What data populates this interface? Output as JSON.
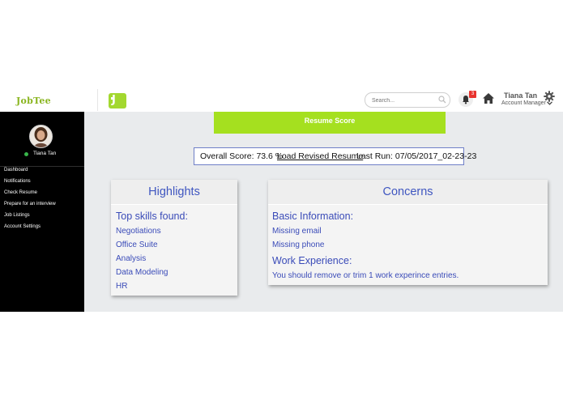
{
  "header": {
    "logo_text": "JobTee",
    "app_icon_glyph": "J",
    "search_placeholder": "Search...",
    "notification_count": "3",
    "user_name": "Tiana Tan",
    "user_role": "Account Manager"
  },
  "sidebar": {
    "profile_name": "Tiana Tan",
    "items": [
      {
        "label": "Dashboard"
      },
      {
        "label": "Notifications"
      },
      {
        "label": "Check Resume"
      },
      {
        "label": "Prepare for an interview"
      },
      {
        "label": "Job Listings"
      },
      {
        "label": "Account Settings"
      }
    ]
  },
  "main": {
    "banner_title": "Resume Score",
    "overall_score": "Overall Score: 73.6 %",
    "load_revised": "Load Revised Resume",
    "last_run": "Last Run: 07/05/2017_02-23-23",
    "highlights": {
      "title": "Highlights",
      "section": "Top skills found:",
      "skills": [
        "Negotiations",
        "Office Suite",
        "Analysis",
        "Data Modeling",
        "HR"
      ]
    },
    "concerns": {
      "title": "Concerns",
      "basic_section": "Basic Information:",
      "basic_items": [
        "Missing email",
        "Missing phone"
      ],
      "work_section": "Work Experience:",
      "work_items": [
        "You should remove or trim 1 work experince entries."
      ]
    }
  },
  "colors": {
    "accent_green": "#a5e01f",
    "sidebar_bg": "#000000",
    "panel_text_blue": "#3a4bb8",
    "badge_red": "#e8332e"
  },
  "icons": [
    "search-icon",
    "bell-icon",
    "home-icon",
    "gear-icon",
    "chevron-down-icon",
    "status-online-icon"
  ]
}
